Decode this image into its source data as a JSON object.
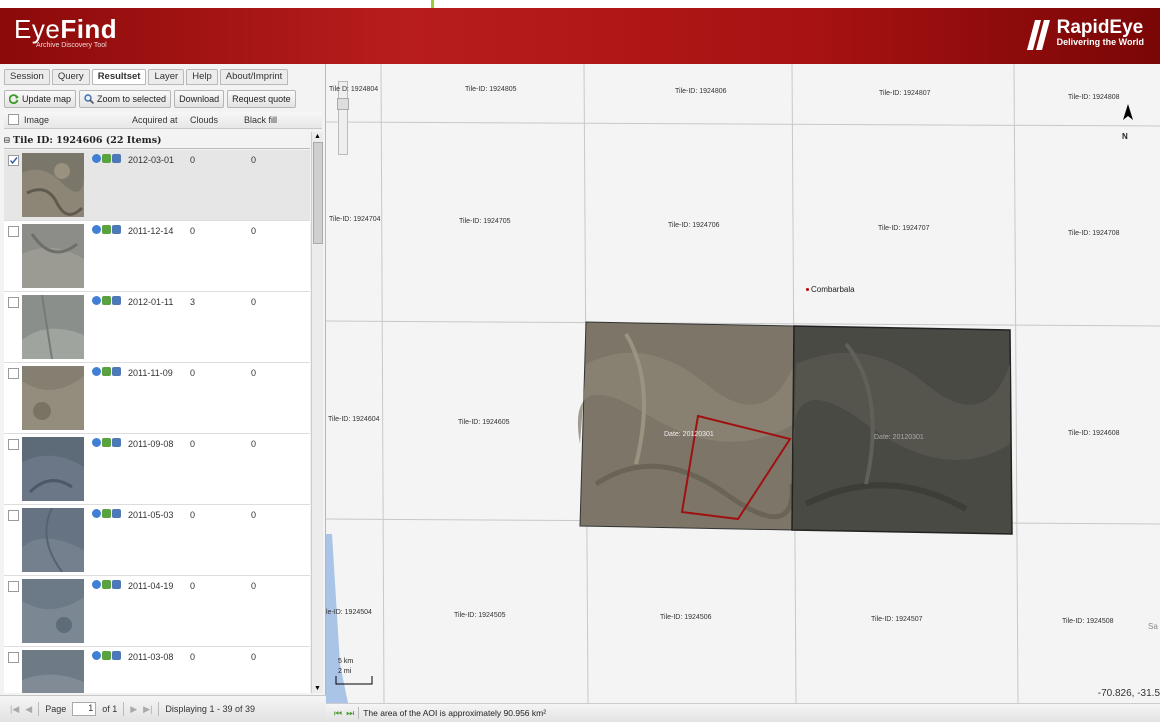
{
  "app": {
    "logo_plain": "Eye",
    "logo_bold": "Find",
    "subtitle": "Archive Discovery Tool",
    "brand_name": "RapidEye",
    "brand_tagline": "Delivering the World"
  },
  "tabs": [
    "Session",
    "Query",
    "Resultset",
    "Layer",
    "Help",
    "About/Imprint"
  ],
  "active_tab": "Resultset",
  "toolbar": {
    "update_map": "Update map",
    "zoom_to_selected": "Zoom to selected",
    "download": "Download",
    "request_quote": "Request quote"
  },
  "columns": {
    "image": "Image",
    "acquired": "Acquired at",
    "clouds": "Clouds",
    "blackfill": "Black fill"
  },
  "group": {
    "label": "Tile ID: 1924606 (22 Items)"
  },
  "rows": [
    {
      "date": "2012-03-01",
      "clouds": "0",
      "blackfill": "0",
      "selected": true
    },
    {
      "date": "2011-12-14",
      "clouds": "0",
      "blackfill": "0",
      "selected": false
    },
    {
      "date": "2012-01-11",
      "clouds": "3",
      "blackfill": "0",
      "selected": false
    },
    {
      "date": "2011-11-09",
      "clouds": "0",
      "blackfill": "0",
      "selected": false
    },
    {
      "date": "2011-09-08",
      "clouds": "0",
      "blackfill": "0",
      "selected": false
    },
    {
      "date": "2011-05-03",
      "clouds": "0",
      "blackfill": "0",
      "selected": false
    },
    {
      "date": "2011-04-19",
      "clouds": "0",
      "blackfill": "0",
      "selected": false
    },
    {
      "date": "2011-03-08",
      "clouds": "0",
      "blackfill": "0",
      "selected": false
    }
  ],
  "pager": {
    "page_label": "Page",
    "page_value": "1",
    "of_label": "of 1",
    "displaying": "Displaying 1 - 39 of 39"
  },
  "map": {
    "tiles": [
      "Tile D: 1924804",
      "Tile-ID: 1924805",
      "Tile-ID: 1924806",
      "Tile-ID: 1924807",
      "Tile-ID: 1924808",
      "Tile-ID: 1924704",
      "Tile-ID: 1924705",
      "Tile-ID: 1924706",
      "Tile-ID: 1924707",
      "Tile-ID: 1924708",
      "Tile-ID: 1924604",
      "Tile-ID: 1924605",
      "Tile-ID: 1924608",
      "le-ID: 1924504",
      "Tile-ID: 1924505",
      "Tile-ID: 1924506",
      "Tile-ID: 1924507",
      "Tile-ID: 1924508"
    ],
    "date_left": "Date: 20120301",
    "date_right": "Date: 20120301",
    "city": "Combarbala",
    "north": "N",
    "scale_km": "5 km",
    "scale_mi": "2 mi",
    "coords": "-70.826, -31.5",
    "edge_text": "Sa"
  },
  "status": {
    "message": "The area of the AOI is approximately 90.956 km²"
  },
  "colors": {
    "header": "#a81212",
    "aoi_outline": "#a01010",
    "map_bg": "#f4f4f4"
  }
}
